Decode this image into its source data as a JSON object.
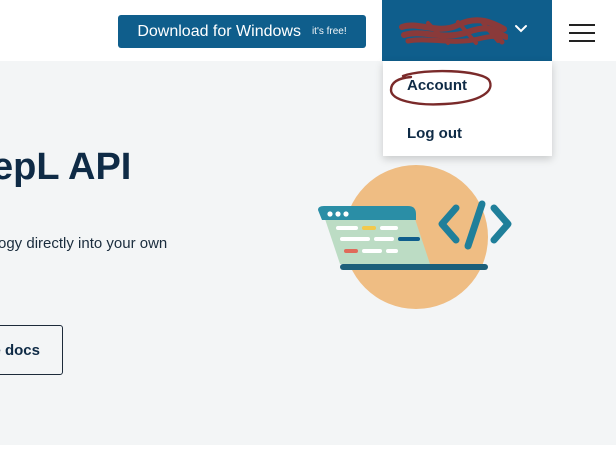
{
  "header": {
    "download_label": "Download for Windows",
    "download_badge": "it's free!",
    "menu_icon": "hamburger-icon",
    "account_chevron_icon": "chevron-down-icon"
  },
  "account_menu": {
    "items": [
      {
        "label": "Account"
      },
      {
        "label": "Log out"
      }
    ]
  },
  "hero": {
    "title": "epL API",
    "subtitle": "ogy directly into your own",
    "docs_button": "e docs"
  },
  "illustration": {
    "icon": "code-window-icon"
  },
  "colors": {
    "brand_blue": "#0f5e8c",
    "page_bg": "#f3f5f6",
    "text_dark": "#0f2b46",
    "illus_circle": "#efbd83",
    "illus_teal": "#2a8ea6",
    "annotation_red": "#7a2a2a"
  }
}
